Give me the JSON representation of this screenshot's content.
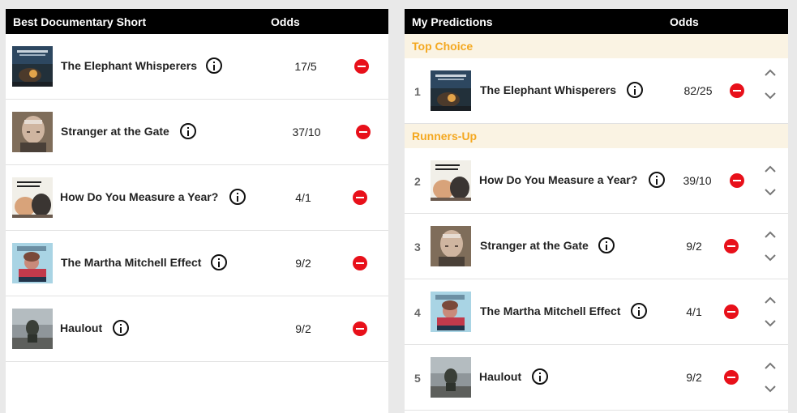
{
  "left": {
    "header": {
      "title": "Best Documentary Short",
      "odds_label": "Odds"
    },
    "nominees": [
      {
        "title": "The Elephant Whisperers",
        "odds": "17/5",
        "thumb": "elephant-whisperers"
      },
      {
        "title": "Stranger at the Gate",
        "odds": "37/10",
        "thumb": "stranger-at-the-gate"
      },
      {
        "title": "How Do You Measure a Year?",
        "odds": "4/1",
        "thumb": "how-do-you-measure"
      },
      {
        "title": "The Martha Mitchell Effect",
        "odds": "9/2",
        "thumb": "martha-mitchell"
      },
      {
        "title": "Haulout",
        "odds": "9/2",
        "thumb": "haulout"
      }
    ]
  },
  "right": {
    "header": {
      "title": "My Predictions",
      "odds_label": "Odds"
    },
    "sections": {
      "top": "Top Choice",
      "runners": "Runners-Up"
    },
    "predictions": [
      {
        "rank": "1",
        "title": "The Elephant Whisperers",
        "odds": "82/25",
        "thumb": "elephant-whisperers"
      },
      {
        "rank": "2",
        "title": "How Do You Measure a Year?",
        "odds": "39/10",
        "thumb": "how-do-you-measure"
      },
      {
        "rank": "3",
        "title": "Stranger at the Gate",
        "odds": "9/2",
        "thumb": "stranger-at-the-gate"
      },
      {
        "rank": "4",
        "title": "The Martha Mitchell Effect",
        "odds": "4/1",
        "thumb": "martha-mitchell"
      },
      {
        "rank": "5",
        "title": "Haulout",
        "odds": "9/2",
        "thumb": "haulout"
      }
    ]
  },
  "colors": {
    "header_bg": "#000000",
    "section_text": "#f4a820",
    "section_bg": "#faf3e3",
    "remove": "#e8101a"
  },
  "icons": {
    "info": "info-icon",
    "remove": "remove-icon",
    "up": "chevron-up-icon",
    "down": "chevron-down-icon"
  }
}
